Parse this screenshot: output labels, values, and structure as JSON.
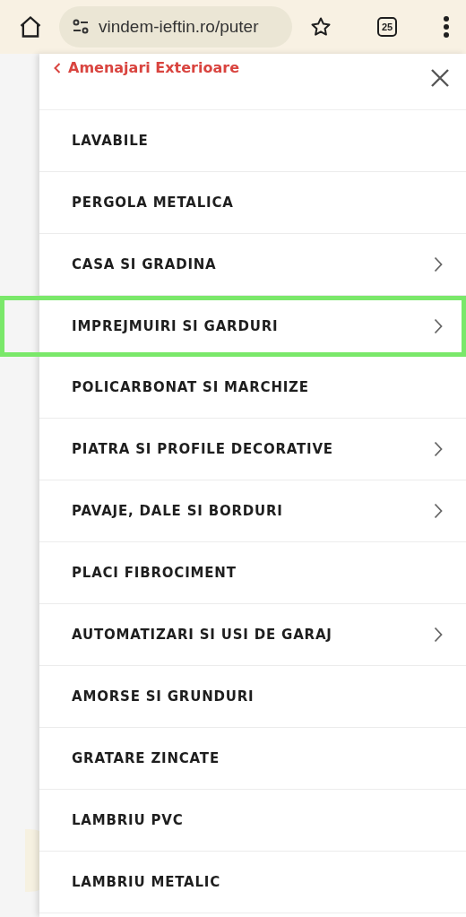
{
  "browser": {
    "url": "vindem-ieftin.ro/puter",
    "tab_count": "25"
  },
  "menu": {
    "back_label": "Amenajari Exterioare",
    "items": [
      {
        "label": "LAVABILE",
        "has_submenu": false,
        "highlighted": false
      },
      {
        "label": "PERGOLA METALICA",
        "has_submenu": false,
        "highlighted": false
      },
      {
        "label": "CASA SI GRADINA",
        "has_submenu": true,
        "highlighted": false
      },
      {
        "label": "IMPREJMUIRI SI GARDURI",
        "has_submenu": true,
        "highlighted": true
      },
      {
        "label": "POLICARBONAT SI MARCHIZE",
        "has_submenu": false,
        "highlighted": false
      },
      {
        "label": "PIATRA SI PROFILE DECORATIVE",
        "has_submenu": true,
        "highlighted": false
      },
      {
        "label": "PAVAJE, DALE SI BORDURI",
        "has_submenu": true,
        "highlighted": false
      },
      {
        "label": "PLACI FIBROCIMENT",
        "has_submenu": false,
        "highlighted": false
      },
      {
        "label": "AUTOMATIZARI SI USI DE GARAJ",
        "has_submenu": true,
        "highlighted": false
      },
      {
        "label": "AMORSE SI GRUNDURI",
        "has_submenu": false,
        "highlighted": false
      },
      {
        "label": "GRATARE ZINCATE",
        "has_submenu": false,
        "highlighted": false
      },
      {
        "label": "LAMBRIU PVC",
        "has_submenu": false,
        "highlighted": false
      },
      {
        "label": "LAMBRIU METALIC",
        "has_submenu": false,
        "highlighted": false
      }
    ]
  }
}
